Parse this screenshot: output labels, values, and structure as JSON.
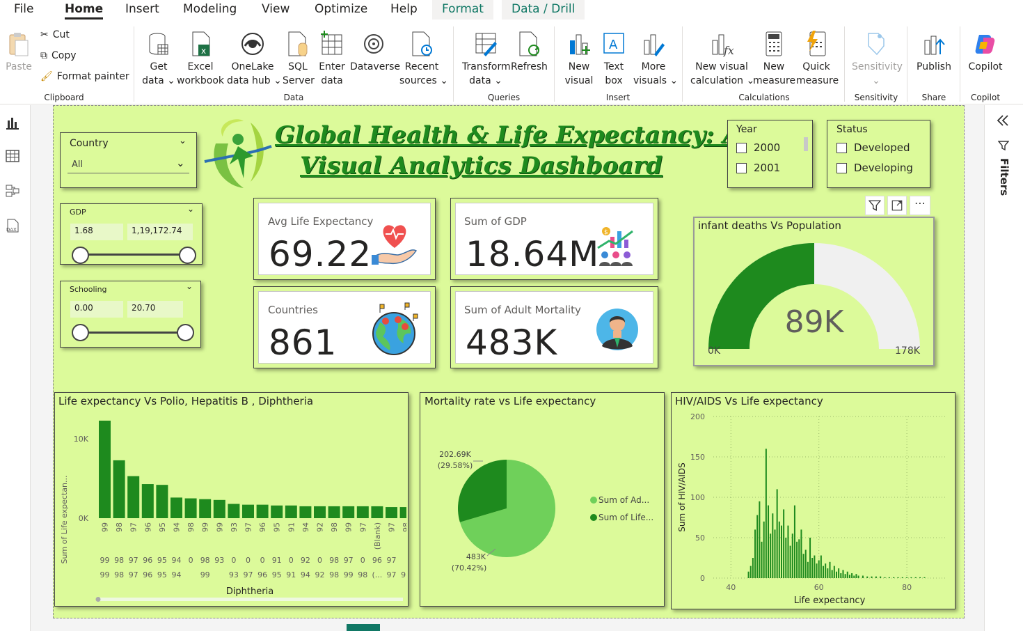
{
  "menu": {
    "items": [
      "File",
      "Home",
      "Insert",
      "Modeling",
      "View",
      "Optimize",
      "Help"
    ],
    "format_tab": "Format",
    "data_drill_tab": "Data / Drill"
  },
  "ribbon": {
    "clipboard": {
      "paste": "Paste",
      "cut": "Cut",
      "copy": "Copy",
      "format_painter": "Format painter",
      "label": "Clipboard"
    },
    "data": {
      "get_data": [
        "Get",
        "data ⌄"
      ],
      "excel": [
        "Excel",
        "workbook"
      ],
      "onelake": [
        "OneLake",
        "data hub ⌄"
      ],
      "sql": [
        "SQL",
        "Server"
      ],
      "enter": [
        "Enter",
        "data"
      ],
      "dataverse": [
        "Dataverse",
        ""
      ],
      "recent": [
        "Recent",
        "sources ⌄"
      ],
      "label": "Data"
    },
    "queries": {
      "transform": [
        "Transform",
        "data ⌄"
      ],
      "refresh": [
        "Refresh",
        ""
      ],
      "label": "Queries"
    },
    "insert": {
      "new_visual": [
        "New",
        "visual"
      ],
      "text_box": [
        "Text",
        "box"
      ],
      "more_visuals": [
        "More",
        "visuals ⌄"
      ],
      "label": "Insert"
    },
    "calculations": {
      "new_visual_calc": [
        "New visual",
        "calculation ⌄"
      ],
      "new_measure": [
        "New",
        "measure"
      ],
      "quick_measure": [
        "Quick",
        "measure"
      ],
      "label": "Calculations"
    },
    "sensitivity": {
      "button": [
        "Sensitivity",
        "⌄"
      ],
      "label": "Sensitivity"
    },
    "share": {
      "publish": [
        "Publish",
        ""
      ],
      "label": "Share"
    },
    "copilot": {
      "button": [
        "Copilot",
        ""
      ],
      "label": "Copilot"
    }
  },
  "filters_pane": {
    "label": "Filters"
  },
  "dashboard": {
    "title_line1": "Global Health & Life Expectancy: A",
    "title_line2": "Visual Analytics Dashboard",
    "country_slicer": {
      "title": "Country",
      "value": "All"
    },
    "gdp_slicer": {
      "title": "GDP",
      "min": "1.68",
      "max": "1,19,172.74"
    },
    "schooling_slicer": {
      "title": "Schooling",
      "min": "0.00",
      "max": "20.70"
    },
    "year_slicer": {
      "title": "Year",
      "options": [
        "2000",
        "2001"
      ]
    },
    "status_slicer": {
      "title": "Status",
      "options": [
        "Developed",
        "Developing"
      ]
    },
    "kpis": {
      "avg_life": {
        "label": "Avg Life Expectancy",
        "value": "69.22"
      },
      "sum_gdp": {
        "label": "Sum of GDP",
        "value": "18.64M"
      },
      "countries": {
        "label": "Countries",
        "value": "861"
      },
      "adult_mortality": {
        "label": "Sum of Adult Mortality",
        "value": "483K"
      }
    },
    "gauge": {
      "title": "infant deaths Vs Population",
      "value_label": "89K",
      "min_label": "0K",
      "max_label": "178K",
      "fraction": 0.5,
      "fill_color": "#1e8a1e",
      "track_color": "#f0f0f0"
    }
  },
  "chart_data": [
    {
      "type": "bar",
      "title": "Life expectancy Vs Polio, Hepatitis B , Diphtheria",
      "xlabel": "Diphtheria",
      "ylabel": "Sum of Life expectan...",
      "y_ticks": [
        "10K",
        "0K"
      ],
      "ylim": [
        0,
        13000
      ],
      "categories_row1": [
        "99",
        "98",
        "97",
        "96",
        "95",
        "94",
        "0",
        "98",
        "93",
        "0",
        "0",
        "0",
        "91",
        "0",
        "92",
        "0",
        "98",
        "97",
        "0",
        "96",
        "97"
      ],
      "categories_row2": [
        "99",
        "98",
        "97",
        "96",
        "95",
        "94",
        "",
        "99",
        "",
        "93",
        "97",
        "96",
        "95",
        "91",
        "94",
        "92",
        "98",
        "99",
        "98",
        "(...",
        "97",
        "98"
      ],
      "categories_row3": [
        "99",
        "98",
        "97",
        "96",
        "95",
        "94",
        "98",
        "99",
        "99",
        "93",
        "97",
        "96",
        "95",
        "91",
        "94",
        "92",
        "98",
        "99",
        "97",
        "(Blank)",
        "97",
        "98"
      ],
      "values": [
        12300,
        7300,
        5300,
        4300,
        4200,
        2600,
        2500,
        2400,
        2300,
        1800,
        1700,
        1700,
        1600,
        1600,
        1500,
        1500,
        1500,
        1500,
        1500,
        1500,
        1400,
        1400
      ],
      "color": "#1e8a1e"
    },
    {
      "type": "pie",
      "title": "Mortality rate vs Life expectancy",
      "slices": [
        {
          "name": "Sum of Ad...",
          "value": 483,
          "label": "483K",
          "pct": "(70.42%)",
          "color": "#6fd05a"
        },
        {
          "name": "Sum of Life...",
          "value": 202.69,
          "label": "202.69K",
          "pct": "(29.58%)",
          "color": "#1e8a1e"
        }
      ]
    },
    {
      "type": "bar",
      "title": "HIV/AIDS Vs Life expectancy",
      "xlabel": "Life expectancy",
      "ylabel": "Sum of HIV/AIDS",
      "x_ticks": [
        "40",
        "60",
        "80"
      ],
      "y_ticks": [
        "200",
        "150",
        "100",
        "50",
        "0"
      ],
      "xlim": [
        36,
        89
      ],
      "ylim": [
        0,
        200
      ],
      "color": "#1e8a1e",
      "x": [
        44,
        44.5,
        45,
        45.5,
        46,
        46.5,
        47,
        47.5,
        48,
        48.5,
        49,
        49.5,
        50,
        50.5,
        51,
        51.5,
        52,
        52.5,
        53,
        53.5,
        54,
        54.5,
        55,
        55.5,
        56,
        56.5,
        57,
        57.5,
        58,
        58.5,
        59,
        59.5,
        60,
        60.5,
        61,
        61.5,
        62,
        62.5,
        63,
        63.5,
        64,
        64.5,
        65,
        65.5,
        66,
        66.5,
        67,
        67.5,
        68,
        68.5,
        69,
        70,
        71,
        72,
        73,
        74,
        75,
        76,
        77,
        78,
        79,
        80,
        81,
        82,
        83,
        84
      ],
      "values": [
        8,
        15,
        25,
        60,
        78,
        95,
        45,
        70,
        160,
        90,
        55,
        80,
        60,
        110,
        70,
        65,
        85,
        50,
        65,
        40,
        55,
        90,
        45,
        48,
        60,
        30,
        35,
        20,
        50,
        25,
        28,
        18,
        22,
        28,
        15,
        18,
        12,
        20,
        10,
        15,
        8,
        12,
        6,
        10,
        5,
        8,
        4,
        6,
        3,
        5,
        3,
        3,
        2,
        2,
        2,
        2,
        1,
        1,
        1,
        1,
        1,
        1,
        1,
        1,
        1,
        1
      ]
    }
  ]
}
